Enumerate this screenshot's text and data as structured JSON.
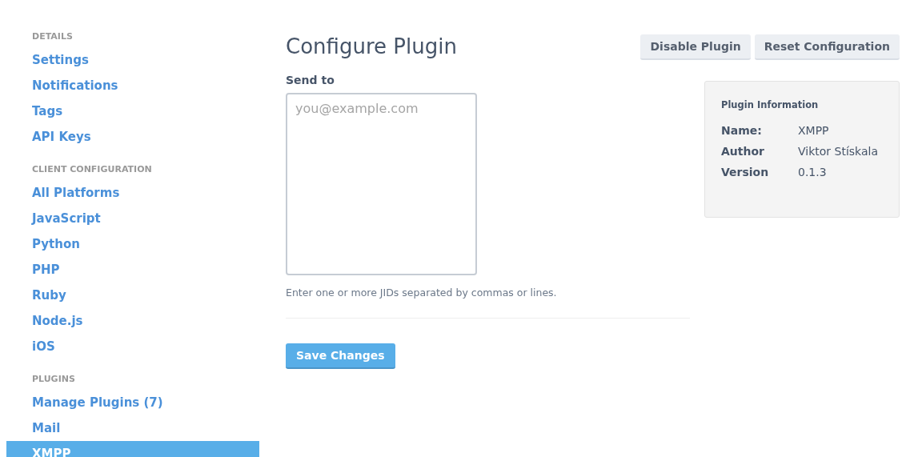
{
  "sidebar": {
    "sections": [
      {
        "heading": "DETAILS",
        "items": [
          {
            "label": "Settings",
            "selected": false
          },
          {
            "label": "Notifications",
            "selected": false
          },
          {
            "label": "Tags",
            "selected": false
          },
          {
            "label": "API Keys",
            "selected": false
          }
        ]
      },
      {
        "heading": "CLIENT CONFIGURATION",
        "items": [
          {
            "label": "All Platforms",
            "selected": false
          },
          {
            "label": "JavaScript",
            "selected": false
          },
          {
            "label": "Python",
            "selected": false
          },
          {
            "label": "PHP",
            "selected": false
          },
          {
            "label": "Ruby",
            "selected": false
          },
          {
            "label": "Node.js",
            "selected": false
          },
          {
            "label": "iOS",
            "selected": false
          }
        ]
      },
      {
        "heading": "PLUGINS",
        "items": [
          {
            "label": "Manage Plugins (7)",
            "selected": false
          },
          {
            "label": "Mail",
            "selected": false
          },
          {
            "label": "XMPP",
            "selected": true
          }
        ]
      }
    ]
  },
  "page": {
    "title": "Configure Plugin",
    "buttons": [
      "Disable Plugin",
      "Reset Configuration"
    ]
  },
  "form": {
    "field_label": "Send to",
    "placeholder": "you@example.com",
    "help": "Enter one or more JIDs separated by commas or lines.",
    "submit": "Save Changes"
  },
  "plugin_info": {
    "title": "Plugin Information",
    "rows": [
      {
        "key": "Name:",
        "value": "XMPP"
      },
      {
        "key": "Author",
        "value": "Viktor Stískala"
      },
      {
        "key": "Version",
        "value": "0.1.3"
      }
    ]
  }
}
